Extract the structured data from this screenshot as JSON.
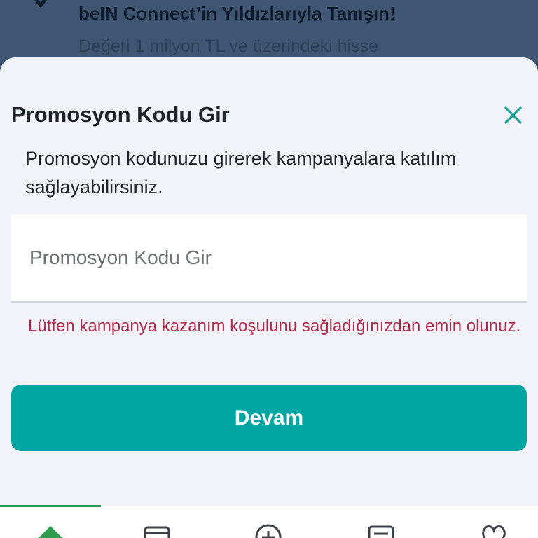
{
  "banner": {
    "title": "beIN Connect’in Yıldızlarıyla Tanışın!",
    "subtitle": "Değeri 1 milyon TL ve üzerindeki hisse"
  },
  "sheet": {
    "title": "Promosyon Kodu Gir",
    "description": "Promosyon kodunuzu girerek kampanyalara katılım sağlayabilirsiniz.",
    "input": {
      "value": "",
      "placeholder": "Promosyon Kodu Gir"
    },
    "warning": "Lütfen kampanya kazanım koşulunu sağladığınızdan emin olunuz.",
    "continue_label": "Devam",
    "close_icon": "close-icon"
  },
  "tabbar": {
    "tabs": [
      {
        "icon": "home-icon",
        "active": true
      },
      {
        "icon": "card-icon",
        "active": false
      },
      {
        "icon": "plus-circle-icon",
        "active": false
      },
      {
        "icon": "list-icon",
        "active": false
      },
      {
        "icon": "heart-icon",
        "active": false
      }
    ]
  },
  "colors": {
    "accent": "#00a6a2",
    "warning": "#b22a4a",
    "active_tab": "#2e9b4e",
    "backdrop": "#3f5672"
  }
}
